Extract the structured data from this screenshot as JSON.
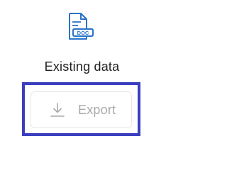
{
  "card": {
    "icon": "document-doc-icon",
    "icon_text": "DOC",
    "title": "Existing data",
    "export_button": {
      "label": "Export",
      "icon": "download-icon",
      "state": "disabled"
    }
  },
  "colors": {
    "icon_blue": "#2b74c9",
    "title_text": "#1f1f1f",
    "disabled_text": "#a9a9a9",
    "highlight_frame": "#3b3fbf"
  }
}
